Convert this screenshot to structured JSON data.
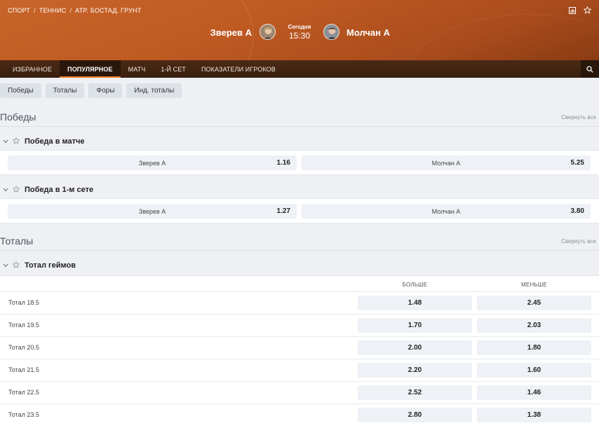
{
  "breadcrumb": [
    "СПОРТ",
    "ТЕННИС",
    "ATP. БОСТАД. ГРУНТ"
  ],
  "breadcrumb_sep": "/",
  "match": {
    "team1": "Зверев А",
    "team2": "Молчан А",
    "time_label": "Сегодня",
    "time": "15:30"
  },
  "nav": {
    "tabs": [
      "ИЗБРАННОЕ",
      "ПОПУЛЯРНОЕ",
      "МАТЧ",
      "1-Й СЕТ",
      "ПОКАЗАТЕЛИ ИГРОКОВ"
    ],
    "active": "ПОПУЛЯРНОЕ"
  },
  "chips": [
    "Победы",
    "Тоталы",
    "Форы",
    "Инд. тоталы"
  ],
  "sections": {
    "wins": {
      "title": "Победы",
      "collapse": "Свернуть все",
      "markets": [
        {
          "name": "Победа в матче",
          "p1": "Зверев А",
          "o1": "1.16",
          "p2": "Молчан А",
          "o2": "5.25"
        },
        {
          "name": "Победа в 1-м сете",
          "p1": "Зверев А",
          "o1": "1.27",
          "p2": "Молчан А",
          "o2": "3.80"
        }
      ]
    },
    "totals": {
      "title": "Тоталы",
      "collapse": "Свернуть все",
      "market_name": "Тотал геймов",
      "col_over": "БОЛЬШЕ",
      "col_under": "МЕНЬШЕ",
      "rows": [
        {
          "label": "Тотал 18.5",
          "over": "1.48",
          "under": "2.45"
        },
        {
          "label": "Тотал 19.5",
          "over": "1.70",
          "under": "2.03"
        },
        {
          "label": "Тотал 20.5",
          "over": "2.00",
          "under": "1.80"
        },
        {
          "label": "Тотал 21.5",
          "over": "2.20",
          "under": "1.60"
        },
        {
          "label": "Тотал 22.5",
          "over": "2.52",
          "under": "1.46"
        },
        {
          "label": "Тотал 23.5",
          "over": "2.80",
          "under": "1.38"
        }
      ]
    }
  },
  "colors": {
    "header": "#c8652a",
    "nav": "#3a2010",
    "accent": "#f07f22"
  },
  "icons": [
    "stats-icon",
    "star-icon",
    "search-icon",
    "chevron-down-icon"
  ]
}
